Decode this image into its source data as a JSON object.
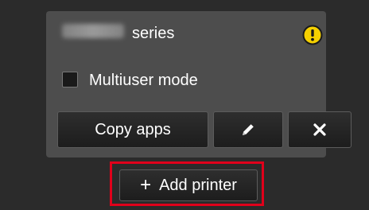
{
  "printer": {
    "series_label": "series",
    "warning_icon": "exclamation-circle-icon",
    "warning_color": "#f5d000"
  },
  "multiuser": {
    "label": "Multiuser mode",
    "checked": false
  },
  "actions": {
    "copy_label": "Copy apps",
    "edit_icon": "pencil-icon",
    "close_icon": "close-icon"
  },
  "add_printer": {
    "plus": "+",
    "label": "Add printer",
    "highlight_color": "#e0001b"
  }
}
